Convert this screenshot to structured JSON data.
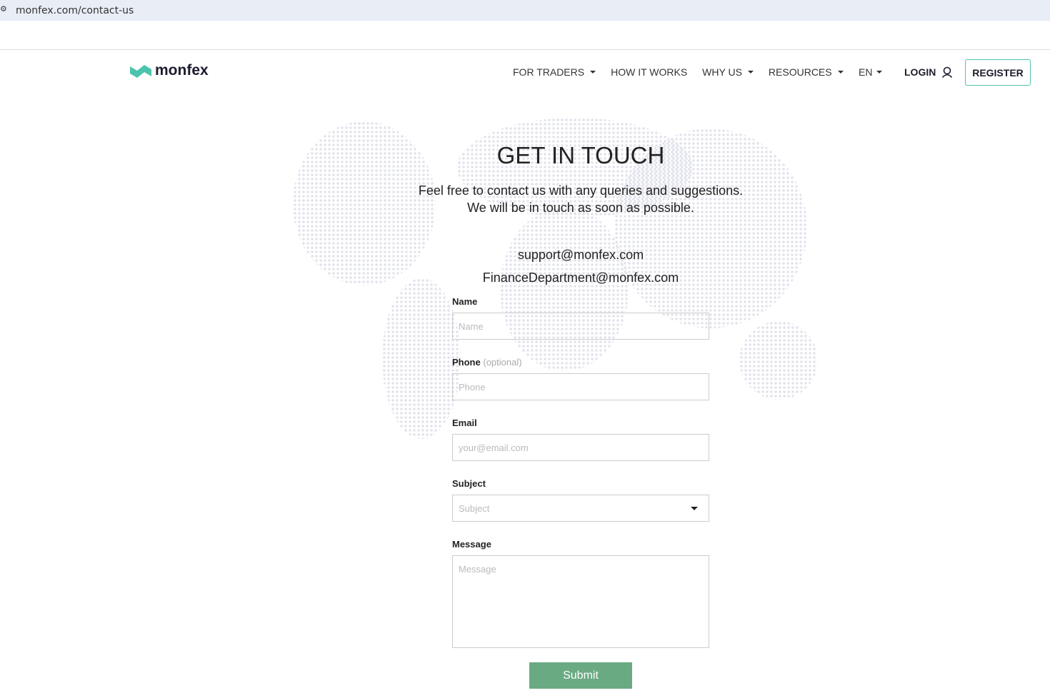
{
  "browser": {
    "url": "monfex.com/contact-us"
  },
  "header": {
    "logo": "monfex",
    "nav": [
      "FOR TRADERS",
      "HOW IT WORKS",
      "WHY US",
      "RESOURCES"
    ],
    "nav_has_caret": [
      true,
      false,
      true,
      true
    ],
    "lang": "EN",
    "login": "LOGIN",
    "register": "REGISTER"
  },
  "main": {
    "title": "GET IN TOUCH",
    "subtitle1": "Feel free to contact us with any queries and suggestions.",
    "subtitle2": "We will be in touch as soon as possible.",
    "email1": "support@monfex.com",
    "email2": "FinanceDepartment@monfex.com"
  },
  "form": {
    "name_label": "Name",
    "name_ph": "Name",
    "phone_label": "Phone",
    "phone_opt": "(optional)",
    "phone_ph": "Phone",
    "email_label": "Email",
    "email_ph": "your@email.com",
    "subject_label": "Subject",
    "subject_ph": "Subject",
    "message_label": "Message",
    "message_ph": "Message",
    "submit": "Submit"
  },
  "colors": {
    "brand": "#4cc3ad",
    "submit": "#6aaa83"
  }
}
